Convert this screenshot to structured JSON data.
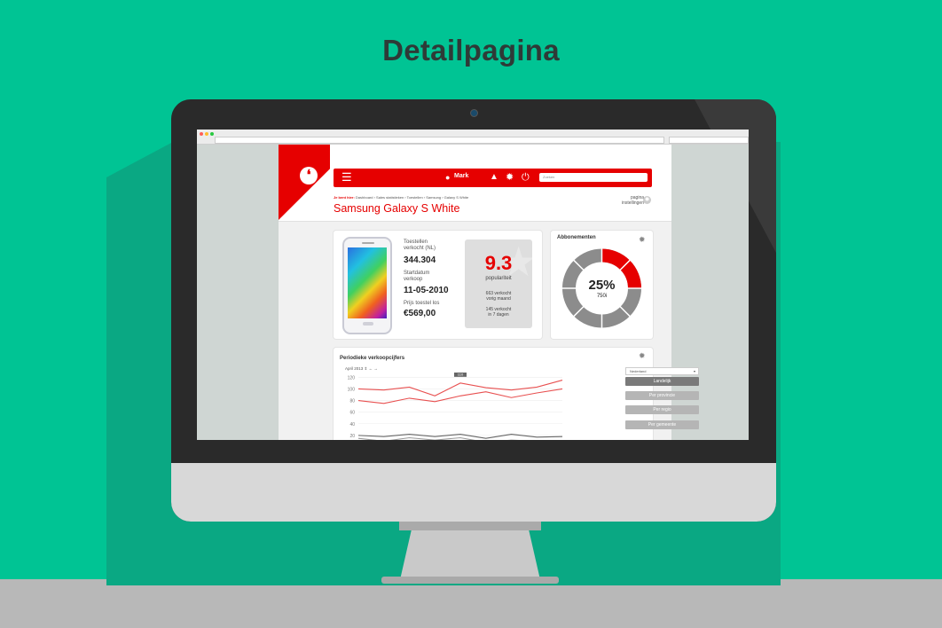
{
  "heading": "Detailpagina",
  "nav": {
    "menu_icon": "☰",
    "user": "Mark",
    "search_placeholder": "Zoeken"
  },
  "breadcrumb": {
    "prefix": "Je bent hier:",
    "path": "Dashboard › Sales statistieken › Toestellen › Samsung › Galaxy S White"
  },
  "page_title": "Samsung Galaxy S White",
  "page_settings": {
    "line1": "pagina",
    "line2": "instellingen"
  },
  "stats": {
    "sold_label": [
      "Toestellen",
      "verkocht (NL)"
    ],
    "sold_value": "344.304",
    "start_label": [
      "Startdatum",
      "verkoop"
    ],
    "start_value": "11-05-2010",
    "price_label": "Prijs toestel los",
    "price_value": "€569,00"
  },
  "popularity": {
    "score": "9.3",
    "label": "populariteit",
    "month_line1": "663 verkocht",
    "month_line2": "vorig maand",
    "week_line1": "145 verkocht",
    "week_line2": "in 7 dagen"
  },
  "subscriptions": {
    "title": "Abbonementen",
    "percent": "25%",
    "count": "750i",
    "fraction": 0.25
  },
  "sales": {
    "title": "Periodieke verkoopcijfers",
    "month": "April 2013",
    "tooltip": "110",
    "region_select": "Nederland",
    "filters": [
      "Landelijk",
      "Per provincie",
      "Per regio",
      "Per gemeente"
    ]
  },
  "colors": {
    "accent": "#e60000",
    "background": "#00c494"
  },
  "chart_data": {
    "type": "line",
    "yticks": [
      120,
      100,
      80,
      60,
      40,
      20
    ],
    "ylim": [
      0,
      125
    ],
    "x": [
      1,
      2,
      3,
      4,
      5,
      6,
      7,
      8,
      9
    ],
    "series": [
      {
        "values": [
          100,
          98,
          103,
          88,
          110,
          102,
          98,
          103,
          115
        ],
        "color": "#e85050"
      },
      {
        "values": [
          80,
          75,
          84,
          78,
          88,
          95,
          85,
          93,
          100
        ],
        "color": "#e85050"
      },
      {
        "values": [
          20,
          18,
          22,
          18,
          22,
          15,
          22,
          17,
          18
        ],
        "color": "#666666"
      },
      {
        "values": [
          15,
          10,
          16,
          12,
          16,
          8,
          12,
          10,
          7
        ],
        "color": "#999999"
      }
    ]
  }
}
